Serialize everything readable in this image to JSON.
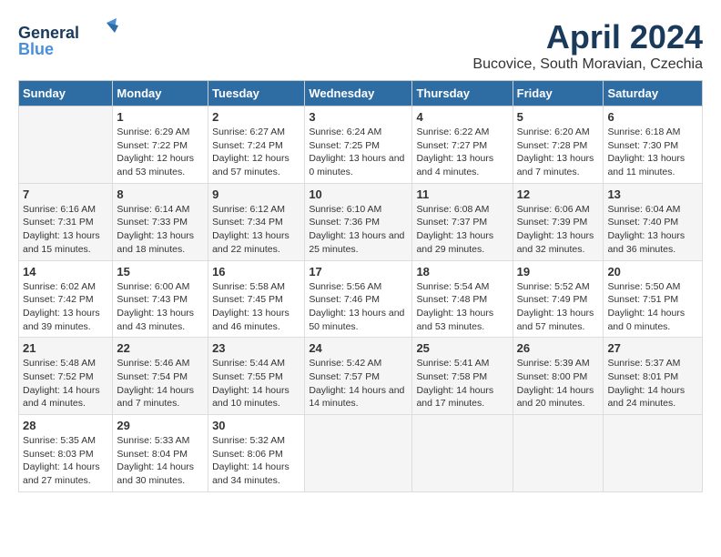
{
  "logo": {
    "general": "General",
    "blue": "Blue"
  },
  "header": {
    "month_year": "April 2024",
    "location": "Bucovice, South Moravian, Czechia"
  },
  "days_of_week": [
    "Sunday",
    "Monday",
    "Tuesday",
    "Wednesday",
    "Thursday",
    "Friday",
    "Saturday"
  ],
  "weeks": [
    [
      {
        "day": "",
        "sunrise": "",
        "sunset": "",
        "daylight": ""
      },
      {
        "day": "1",
        "sunrise": "Sunrise: 6:29 AM",
        "sunset": "Sunset: 7:22 PM",
        "daylight": "Daylight: 12 hours and 53 minutes."
      },
      {
        "day": "2",
        "sunrise": "Sunrise: 6:27 AM",
        "sunset": "Sunset: 7:24 PM",
        "daylight": "Daylight: 12 hours and 57 minutes."
      },
      {
        "day": "3",
        "sunrise": "Sunrise: 6:24 AM",
        "sunset": "Sunset: 7:25 PM",
        "daylight": "Daylight: 13 hours and 0 minutes."
      },
      {
        "day": "4",
        "sunrise": "Sunrise: 6:22 AM",
        "sunset": "Sunset: 7:27 PM",
        "daylight": "Daylight: 13 hours and 4 minutes."
      },
      {
        "day": "5",
        "sunrise": "Sunrise: 6:20 AM",
        "sunset": "Sunset: 7:28 PM",
        "daylight": "Daylight: 13 hours and 7 minutes."
      },
      {
        "day": "6",
        "sunrise": "Sunrise: 6:18 AM",
        "sunset": "Sunset: 7:30 PM",
        "daylight": "Daylight: 13 hours and 11 minutes."
      }
    ],
    [
      {
        "day": "7",
        "sunrise": "Sunrise: 6:16 AM",
        "sunset": "Sunset: 7:31 PM",
        "daylight": "Daylight: 13 hours and 15 minutes."
      },
      {
        "day": "8",
        "sunrise": "Sunrise: 6:14 AM",
        "sunset": "Sunset: 7:33 PM",
        "daylight": "Daylight: 13 hours and 18 minutes."
      },
      {
        "day": "9",
        "sunrise": "Sunrise: 6:12 AM",
        "sunset": "Sunset: 7:34 PM",
        "daylight": "Daylight: 13 hours and 22 minutes."
      },
      {
        "day": "10",
        "sunrise": "Sunrise: 6:10 AM",
        "sunset": "Sunset: 7:36 PM",
        "daylight": "Daylight: 13 hours and 25 minutes."
      },
      {
        "day": "11",
        "sunrise": "Sunrise: 6:08 AM",
        "sunset": "Sunset: 7:37 PM",
        "daylight": "Daylight: 13 hours and 29 minutes."
      },
      {
        "day": "12",
        "sunrise": "Sunrise: 6:06 AM",
        "sunset": "Sunset: 7:39 PM",
        "daylight": "Daylight: 13 hours and 32 minutes."
      },
      {
        "day": "13",
        "sunrise": "Sunrise: 6:04 AM",
        "sunset": "Sunset: 7:40 PM",
        "daylight": "Daylight: 13 hours and 36 minutes."
      }
    ],
    [
      {
        "day": "14",
        "sunrise": "Sunrise: 6:02 AM",
        "sunset": "Sunset: 7:42 PM",
        "daylight": "Daylight: 13 hours and 39 minutes."
      },
      {
        "day": "15",
        "sunrise": "Sunrise: 6:00 AM",
        "sunset": "Sunset: 7:43 PM",
        "daylight": "Daylight: 13 hours and 43 minutes."
      },
      {
        "day": "16",
        "sunrise": "Sunrise: 5:58 AM",
        "sunset": "Sunset: 7:45 PM",
        "daylight": "Daylight: 13 hours and 46 minutes."
      },
      {
        "day": "17",
        "sunrise": "Sunrise: 5:56 AM",
        "sunset": "Sunset: 7:46 PM",
        "daylight": "Daylight: 13 hours and 50 minutes."
      },
      {
        "day": "18",
        "sunrise": "Sunrise: 5:54 AM",
        "sunset": "Sunset: 7:48 PM",
        "daylight": "Daylight: 13 hours and 53 minutes."
      },
      {
        "day": "19",
        "sunrise": "Sunrise: 5:52 AM",
        "sunset": "Sunset: 7:49 PM",
        "daylight": "Daylight: 13 hours and 57 minutes."
      },
      {
        "day": "20",
        "sunrise": "Sunrise: 5:50 AM",
        "sunset": "Sunset: 7:51 PM",
        "daylight": "Daylight: 14 hours and 0 minutes."
      }
    ],
    [
      {
        "day": "21",
        "sunrise": "Sunrise: 5:48 AM",
        "sunset": "Sunset: 7:52 PM",
        "daylight": "Daylight: 14 hours and 4 minutes."
      },
      {
        "day": "22",
        "sunrise": "Sunrise: 5:46 AM",
        "sunset": "Sunset: 7:54 PM",
        "daylight": "Daylight: 14 hours and 7 minutes."
      },
      {
        "day": "23",
        "sunrise": "Sunrise: 5:44 AM",
        "sunset": "Sunset: 7:55 PM",
        "daylight": "Daylight: 14 hours and 10 minutes."
      },
      {
        "day": "24",
        "sunrise": "Sunrise: 5:42 AM",
        "sunset": "Sunset: 7:57 PM",
        "daylight": "Daylight: 14 hours and 14 minutes."
      },
      {
        "day": "25",
        "sunrise": "Sunrise: 5:41 AM",
        "sunset": "Sunset: 7:58 PM",
        "daylight": "Daylight: 14 hours and 17 minutes."
      },
      {
        "day": "26",
        "sunrise": "Sunrise: 5:39 AM",
        "sunset": "Sunset: 8:00 PM",
        "daylight": "Daylight: 14 hours and 20 minutes."
      },
      {
        "day": "27",
        "sunrise": "Sunrise: 5:37 AM",
        "sunset": "Sunset: 8:01 PM",
        "daylight": "Daylight: 14 hours and 24 minutes."
      }
    ],
    [
      {
        "day": "28",
        "sunrise": "Sunrise: 5:35 AM",
        "sunset": "Sunset: 8:03 PM",
        "daylight": "Daylight: 14 hours and 27 minutes."
      },
      {
        "day": "29",
        "sunrise": "Sunrise: 5:33 AM",
        "sunset": "Sunset: 8:04 PM",
        "daylight": "Daylight: 14 hours and 30 minutes."
      },
      {
        "day": "30",
        "sunrise": "Sunrise: 5:32 AM",
        "sunset": "Sunset: 8:06 PM",
        "daylight": "Daylight: 14 hours and 34 minutes."
      },
      {
        "day": "",
        "sunrise": "",
        "sunset": "",
        "daylight": ""
      },
      {
        "day": "",
        "sunrise": "",
        "sunset": "",
        "daylight": ""
      },
      {
        "day": "",
        "sunrise": "",
        "sunset": "",
        "daylight": ""
      },
      {
        "day": "",
        "sunrise": "",
        "sunset": "",
        "daylight": ""
      }
    ]
  ]
}
